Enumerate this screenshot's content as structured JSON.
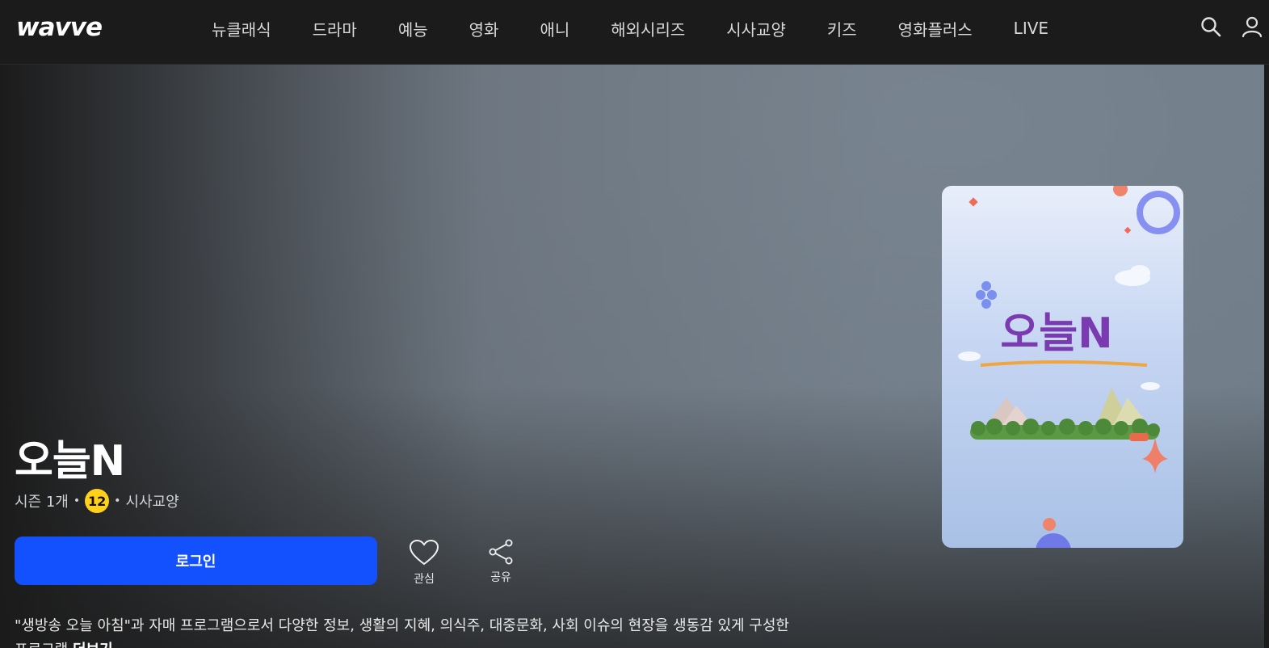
{
  "brand": {
    "logo_text": "wavve"
  },
  "nav": {
    "items": [
      {
        "label": "뉴클래식"
      },
      {
        "label": "드라마"
      },
      {
        "label": "예능"
      },
      {
        "label": "영화"
      },
      {
        "label": "애니"
      },
      {
        "label": "해외시리즈"
      },
      {
        "label": "시사교양"
      },
      {
        "label": "키즈"
      },
      {
        "label": "영화플러스"
      },
      {
        "label": "LIVE"
      }
    ]
  },
  "header_icons": {
    "search": "search-icon",
    "profile": "user-icon"
  },
  "program": {
    "title": "오늘N",
    "season": "시즌 1개",
    "age_rating": "12",
    "genre": "시사교양",
    "poster_logo": "오늘N"
  },
  "actions": {
    "login_label": "로그인",
    "favorite_label": "관심",
    "share_label": "공유"
  },
  "description": {
    "text": "\"생방송 오늘 아침\"과 자매 프로그램으로서 다양한 정보, 생활의 지혜, 의식주, 대중문화, 사회 이슈의 현장을 생동감 있게 구성한 프로그램",
    "more_label": "더보기"
  },
  "colors": {
    "accent": "#1351ff",
    "age_badge": "#ffd11a",
    "header_bg": "#1b1b1b"
  }
}
